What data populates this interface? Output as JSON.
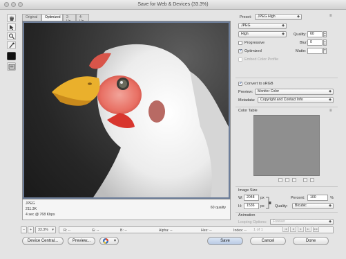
{
  "window": {
    "title": "Save for Web & Devices (33.3%)"
  },
  "tabs": [
    {
      "label": "Original"
    },
    {
      "label": "Optimized"
    },
    {
      "label": "2-Up"
    },
    {
      "label": "4-Up"
    }
  ],
  "preview_info": {
    "format": "JPEG",
    "size": "211.3K",
    "time": "4 sec @ 768 Kbps",
    "quality_note": "60 quality"
  },
  "status_bar": {
    "zoom": "33.3%",
    "r": "R: --",
    "g": "G: --",
    "b": "B: --",
    "alpha": "Alpha: --",
    "hex": "Hex: --",
    "index": "Index: --"
  },
  "buttons": {
    "device_central": "Device Central...",
    "preview": "Preview...",
    "save": "Save",
    "cancel": "Cancel",
    "done": "Done"
  },
  "settings": {
    "preset_label": "Preset:",
    "preset_value": "JPEG High",
    "format_value": "JPEG",
    "quality_level": "High",
    "quality_label": "Quality:",
    "quality_value": "60",
    "blur_label": "Blur:",
    "blur_value": "0",
    "matte_label": "Matte:",
    "progressive_label": "Progressive",
    "progressive_checked": false,
    "optimized_label": "Optimized",
    "optimized_checked": true,
    "embed_label": "Embed Color Profile",
    "embed_checked": false,
    "convert_label": "Convert to sRGB",
    "convert_checked": true,
    "preview_label": "Preview:",
    "preview_value": "Monitor Color",
    "metadata_label": "Metadata:",
    "metadata_value": "Copyright and Contact Info"
  },
  "color_table": {
    "title": "Color Table"
  },
  "image_size": {
    "title": "Image Size",
    "w_label": "W:",
    "w_value": "2048",
    "h_label": "H:",
    "h_value": "1536",
    "unit": "px",
    "percent_label": "Percent:",
    "percent_value": "100",
    "percent_unit": "%",
    "quality_label": "Quality:",
    "quality_value": "Bicubic"
  },
  "animation": {
    "title": "Animation",
    "looping_label": "Looping Options:",
    "looping_value": "Forever",
    "frame_counter": "1 of 1"
  },
  "colors": {
    "window_bg": "#e4e4e4",
    "preview_border": "#6d7e9a",
    "color_table_fill": "#8f8f8f"
  },
  "icons": [
    "hand-tool-icon",
    "slice-select-tool-icon",
    "zoom-tool-icon",
    "eyedropper-tool-icon",
    "eyedropper-color-swatch-icon",
    "toggle-slices-icon",
    "panel-menu-icon",
    "browser-icon"
  ]
}
